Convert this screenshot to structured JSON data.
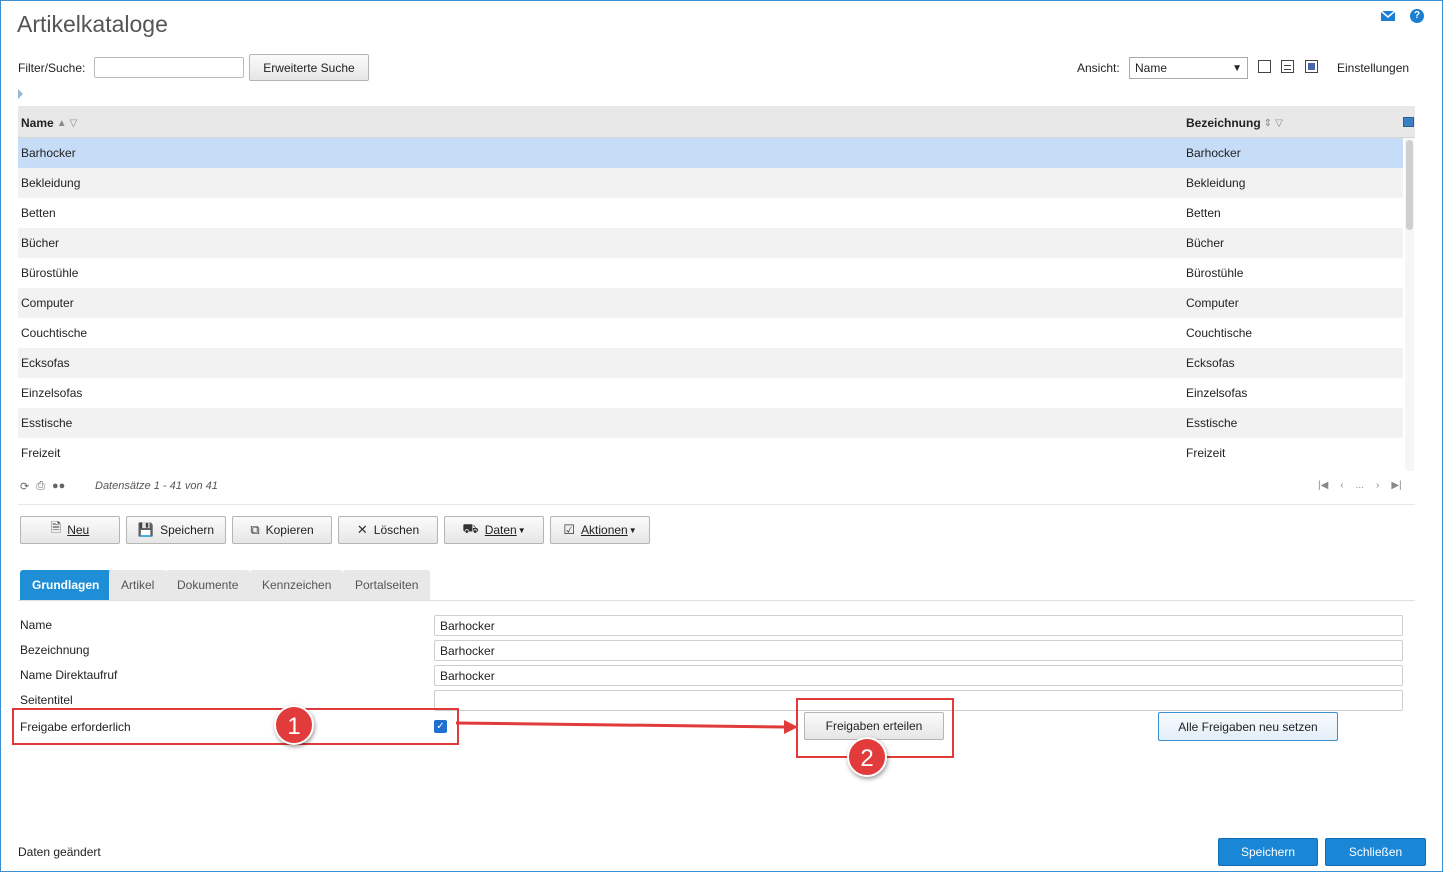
{
  "window": {
    "title": "Artikelkataloge"
  },
  "filter": {
    "label": "Filter/Suche:",
    "value": "",
    "placeholder": "",
    "search_button": "Erweiterte Suche"
  },
  "view": {
    "label": "Ansicht:",
    "selected": "Name",
    "settings_label": "Einstellungen"
  },
  "grid": {
    "columns": [
      "Name",
      "Bezeichnung"
    ],
    "rows": [
      {
        "name": "Barhocker",
        "bezeichnung": "Barhocker"
      },
      {
        "name": "Bekleidung",
        "bezeichnung": "Bekleidung"
      },
      {
        "name": "Betten",
        "bezeichnung": "Betten"
      },
      {
        "name": "Bücher",
        "bezeichnung": "Bücher"
      },
      {
        "name": "Bürostühle",
        "bezeichnung": "Bürostühle"
      },
      {
        "name": "Computer",
        "bezeichnung": "Computer"
      },
      {
        "name": "Couchtische",
        "bezeichnung": "Couchtische"
      },
      {
        "name": "Ecksofas",
        "bezeichnung": "Ecksofas"
      },
      {
        "name": "Einzelsofas",
        "bezeichnung": "Einzelsofas"
      },
      {
        "name": "Esstische",
        "bezeichnung": "Esstische"
      },
      {
        "name": "Freizeit",
        "bezeichnung": "Freizeit"
      }
    ],
    "selected_index": 0,
    "record_info": "Datensätze 1 - 41 von 41",
    "pager": {
      "ellipsis": "..."
    }
  },
  "actions": {
    "new": "Neu",
    "save": "Speichern",
    "copy": "Kopieren",
    "delete": "Löschen",
    "data": "Daten",
    "actions": "Aktionen"
  },
  "tabs": [
    "Grundlagen",
    "Artikel",
    "Dokumente",
    "Kennzeichen",
    "Portalseiten"
  ],
  "form": {
    "name_label": "Name",
    "name_value": "Barhocker",
    "bezeichnung_label": "Bezeichnung",
    "bezeichnung_value": "Barhocker",
    "direkt_label": "Name Direktaufruf",
    "direkt_value": "Barhocker",
    "seitentitel_label": "Seitentitel",
    "seitentitel_value": "",
    "freigabe_label": "Freigabe erforderlich",
    "freigabe_checked": true,
    "grant_button": "Freigaben erteilen",
    "reset_button": "Alle Freigaben neu setzen"
  },
  "annotations": {
    "marker_1": "1",
    "marker_2": "2",
    "color": "#e03a3a"
  },
  "footer": {
    "status": "Daten geändert",
    "save": "Speichern",
    "close": "Schließen"
  },
  "colors": {
    "accent": "#1a86d6",
    "selected_row": "#c7dcf7"
  }
}
